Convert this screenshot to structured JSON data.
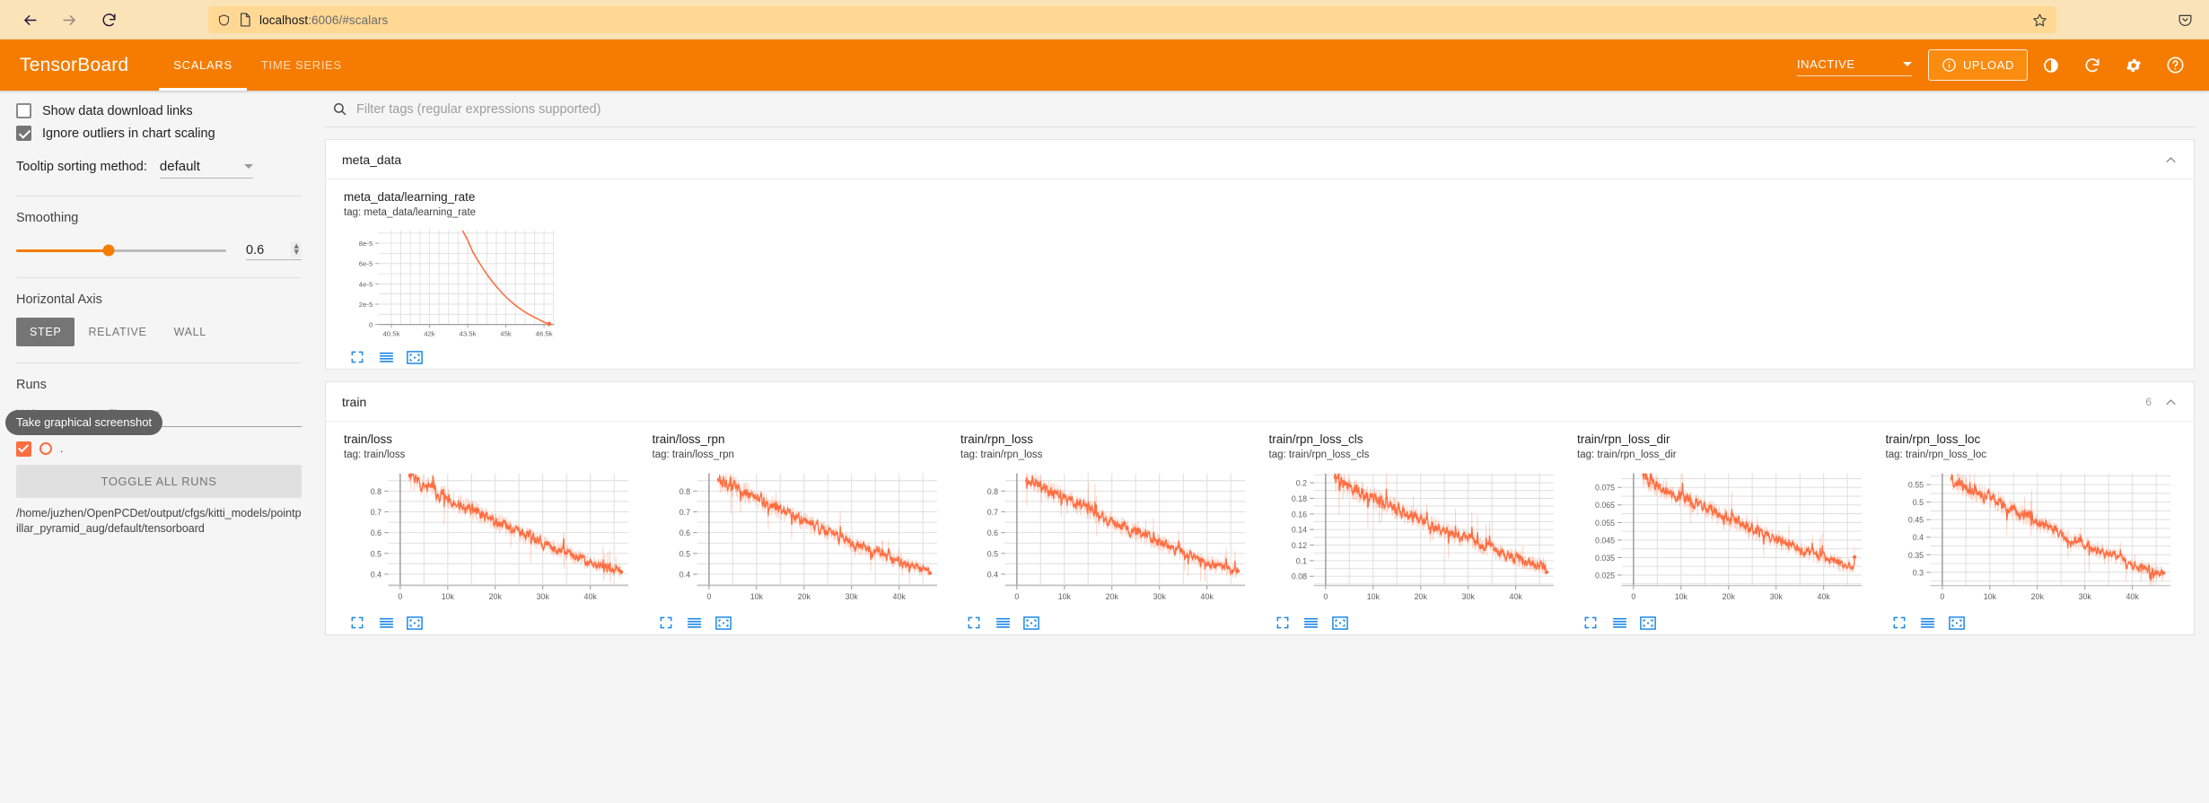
{
  "browser": {
    "back_icon": "arrow-left-icon",
    "forward_icon": "arrow-right-icon",
    "reload_icon": "reload-icon",
    "shield_icon": "shield-icon",
    "page_icon": "page-icon",
    "url_host": "localhost",
    "url_rest": ":6006/#scalars",
    "bookmark_icon": "star-icon",
    "pocket_icon": "pocket-icon"
  },
  "header": {
    "logo": "TensorBoard",
    "tabs": [
      {
        "label": "SCALARS",
        "active": true
      },
      {
        "label": "TIME SERIES",
        "active": false
      }
    ],
    "run_selector_value": "INACTIVE",
    "upload_label": "UPLOAD",
    "upload_icon": "info-circle-icon",
    "icons": [
      "contrast-icon",
      "reload-icon",
      "gear-icon",
      "help-icon"
    ],
    "accent_color": "#f57c00"
  },
  "sidebar": {
    "show_download_links": {
      "label": "Show data download links",
      "checked": false
    },
    "ignore_outliers": {
      "label": "Ignore outliers in chart scaling",
      "checked": true
    },
    "tooltip_sorting": {
      "label": "Tooltip sorting method:",
      "value": "default"
    },
    "smoothing": {
      "title": "Smoothing",
      "value": "0.6",
      "fraction": 44
    },
    "horizontal_axis": {
      "title": "Horizontal Axis",
      "options": [
        {
          "label": "STEP",
          "active": true
        },
        {
          "label": "RELATIVE",
          "active": false
        },
        {
          "label": "WALL",
          "active": false
        }
      ]
    },
    "runs": {
      "title": "Runs",
      "regex_placeholder": "Write a regex to filter runs",
      "tooltip": "Take graphical screenshot",
      "run_label": ".",
      "toggle_all_label": "TOGGLE ALL RUNS",
      "path": "/home/juzhen/OpenPCDet/output/cfgs/kitti_models/pointpillar_pyramid_aug/default/tensorboard",
      "run_color": "#ff6d40"
    }
  },
  "main": {
    "filter_placeholder": "Filter tags (regular expressions supported)",
    "filter_icon": "search-icon",
    "groups": [
      {
        "name": "meta_data",
        "count": "",
        "expanded": true
      },
      {
        "name": "train",
        "count": "6",
        "expanded": true
      }
    ],
    "chart_action_icons": [
      "expand-icon",
      "lines-icon",
      "reset-axes-icon"
    ],
    "series_color": "#ff6d40"
  },
  "chart_data": [
    {
      "type": "line",
      "title": "meta_data/learning_rate",
      "tag": "tag: meta_data/learning_rate",
      "group": "meta_data",
      "xlabel": "",
      "ylabel": "",
      "xticks": [
        "40.5k",
        "42k",
        "43.5k",
        "45k",
        "46.5k"
      ],
      "yticks": [
        "0",
        "2e-5",
        "4e-5",
        "6e-5",
        "8e-5"
      ],
      "xlim": [
        40000,
        46900
      ],
      "ylim": [
        0,
        9.3e-05
      ],
      "grid": true,
      "legend": "none",
      "endpoint_marker": true,
      "x": [
        43300,
        43500,
        43700,
        43900,
        44100,
        44300,
        44500,
        44700,
        44900,
        45100,
        45300,
        45500,
        45700,
        45900,
        46100,
        46300,
        46500,
        46700
      ],
      "y": [
        9.25e-05,
        8.3e-05,
        7.15e-05,
        6.3e-05,
        5.5e-05,
        4.78e-05,
        4.12e-05,
        3.52e-05,
        2.97e-05,
        2.48e-05,
        2.04e-05,
        1.65e-05,
        1.3e-05,
        1e-05,
        7.2e-06,
        4.8e-06,
        2.2e-06,
        5e-07
      ]
    },
    {
      "type": "line",
      "title": "train/loss",
      "tag": "tag: train/loss",
      "group": "train",
      "xticks": [
        "0",
        "10k",
        "20k",
        "30k",
        "40k"
      ],
      "yticks": [
        "0.4",
        "0.5",
        "0.6",
        "0.7",
        "0.8"
      ],
      "xlim": [
        -2500,
        48000
      ],
      "ylim": [
        0.345,
        0.885
      ],
      "grid": true,
      "noise": 0.055,
      "start": 0.86,
      "end": 0.41
    },
    {
      "type": "line",
      "title": "train/loss_rpn",
      "tag": "tag: train/loss_rpn",
      "group": "train",
      "xticks": [
        "0",
        "10k",
        "20k",
        "30k",
        "40k"
      ],
      "yticks": [
        "0.4",
        "0.5",
        "0.6",
        "0.7",
        "0.8"
      ],
      "xlim": [
        -2500,
        48000
      ],
      "ylim": [
        0.345,
        0.885
      ],
      "grid": true,
      "noise": 0.055,
      "start": 0.86,
      "end": 0.41
    },
    {
      "type": "line",
      "title": "train/rpn_loss",
      "tag": "tag: train/rpn_loss",
      "group": "train",
      "xticks": [
        "0",
        "10k",
        "20k",
        "30k",
        "40k"
      ],
      "yticks": [
        "0.4",
        "0.5",
        "0.6",
        "0.7",
        "0.8"
      ],
      "xlim": [
        -2500,
        48000
      ],
      "ylim": [
        0.345,
        0.885
      ],
      "grid": true,
      "noise": 0.055,
      "start": 0.86,
      "end": 0.41
    },
    {
      "type": "line",
      "title": "train/rpn_loss_cls",
      "tag": "tag: train/rpn_loss_cls",
      "group": "train",
      "xticks": [
        "0",
        "10k",
        "20k",
        "30k",
        "40k"
      ],
      "yticks": [
        "0.08",
        "0.1",
        "0.12",
        "0.14",
        "0.16",
        "0.18",
        "0.2"
      ],
      "xlim": [
        -2500,
        48000
      ],
      "ylim": [
        0.068,
        0.212
      ],
      "grid": true,
      "noise": 0.016,
      "start": 0.203,
      "end": 0.091
    },
    {
      "type": "line",
      "title": "train/rpn_loss_dir",
      "tag": "tag: train/rpn_loss_dir",
      "group": "train",
      "xticks": [
        "0",
        "10k",
        "20k",
        "30k",
        "40k"
      ],
      "yticks": [
        "0.025",
        "0.035",
        "0.045",
        "0.055",
        "0.065",
        "0.075"
      ],
      "xlim": [
        -2500,
        48000
      ],
      "ylim": [
        0.019,
        0.083
      ],
      "grid": true,
      "noise": 0.007,
      "start": 0.08,
      "end": 0.029
    },
    {
      "type": "line",
      "title": "train/rpn_loss_loc",
      "tag": "tag: train/rpn_loss_loc",
      "group": "train",
      "xticks": [
        "0",
        "10k",
        "20k",
        "30k",
        "40k"
      ],
      "yticks": [
        "0.3",
        "0.35",
        "0.4",
        "0.45",
        "0.5",
        "0.55"
      ],
      "xlim": [
        -2500,
        48000
      ],
      "ylim": [
        0.262,
        0.582
      ],
      "grid": true,
      "noise": 0.032,
      "start": 0.565,
      "end": 0.295
    }
  ]
}
